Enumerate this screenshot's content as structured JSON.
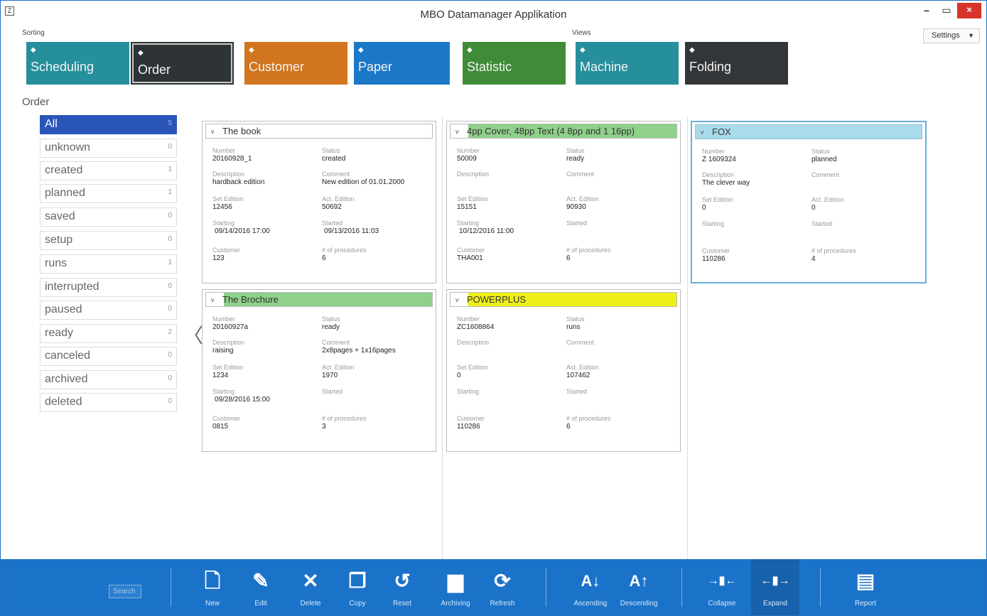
{
  "window": {
    "title": "MBO Datamanager Applikation",
    "app_icon": "Z",
    "min_glyph": "–",
    "max_glyph": "▭",
    "close_glyph": "×"
  },
  "header": {
    "sorting_label": "Sorting",
    "views_label": "Views",
    "settings_label": "Settings",
    "settings_caret": "▼"
  },
  "tiles": [
    {
      "label": "Scheduling",
      "icon": "cube-icon",
      "color": "#268f9c"
    },
    {
      "label": "Order",
      "icon": "cube-icon",
      "color": "#2e3436"
    },
    {
      "label": "Customer",
      "icon": "cube-icon",
      "color": "#d1761e"
    },
    {
      "label": "Paper",
      "icon": "cube-icon",
      "color": "#1b78c6"
    },
    {
      "label": "Statistic",
      "icon": "cube-icon",
      "color": "#3f8b37"
    },
    {
      "label": "Machine",
      "icon": "cube-icon",
      "color": "#268f9c"
    },
    {
      "label": "Folding",
      "icon": "cube-icon",
      "color": "#333638"
    }
  ],
  "section_label": "Order",
  "filters": [
    {
      "label": "All",
      "count": "5"
    },
    {
      "label": "unknown",
      "count": "0"
    },
    {
      "label": "created",
      "count": "1"
    },
    {
      "label": "planned",
      "count": "1"
    },
    {
      "label": "saved",
      "count": "0"
    },
    {
      "label": "setup",
      "count": "0"
    },
    {
      "label": "runs",
      "count": "1"
    },
    {
      "label": "interrupted",
      "count": "0"
    },
    {
      "label": "paused",
      "count": "0"
    },
    {
      "label": "ready",
      "count": "2"
    },
    {
      "label": "canceled",
      "count": "0"
    },
    {
      "label": "archived",
      "count": "0"
    },
    {
      "label": "deleted",
      "count": "0"
    }
  ],
  "collapse_arrow": "〈",
  "field_labels": {
    "number": "Number",
    "status": "Status",
    "description": "Description",
    "comment": "Comment",
    "set_edition": "Set Edition",
    "act_edition": "Act. Edition",
    "starting": "Starting",
    "started": "Started",
    "customer": "Customer",
    "procedures": "# of procedures"
  },
  "cards": [
    {
      "title": "The book",
      "chevron": "v",
      "highlight": "none",
      "number": "20160928_1",
      "status": "created",
      "description": "hardback edition",
      "comment": "New edition of 01.01.2000",
      "set_edition": "12456",
      "act_edition": "50692",
      "starting": "09/14/2016 17:00",
      "started": "09/13/2016 11:03",
      "customer": "123",
      "procedures": "6"
    },
    {
      "title": "The Brochure",
      "chevron": "v",
      "highlight": "#8fd08a",
      "number": "20160927a",
      "status": "ready",
      "description": "raising",
      "comment": "2x8pages + 1x16pages",
      "set_edition": "1234",
      "act_edition": "1970",
      "starting": "09/28/2016 15:00",
      "started": "",
      "customer": "0815",
      "procedures": "3"
    },
    {
      "title": "4pp Cover, 48pp Text (4 8pp and 1 16pp)",
      "chevron": "v",
      "highlight": "#8fd08a",
      "number": "50009",
      "status": "ready",
      "description": "",
      "comment": "",
      "set_edition": "15151",
      "act_edition": "90930",
      "starting": "10/12/2016 11:00",
      "started": "",
      "customer": "THA001",
      "procedures": "6"
    },
    {
      "title": "POWERPLUS",
      "chevron": "v",
      "highlight": "#eeee1b",
      "number": "ZC1608864",
      "status": "runs",
      "description": "",
      "comment": "",
      "set_edition": "0",
      "act_edition": "107462",
      "starting": "",
      "started": "",
      "customer": "110286",
      "procedures": "6"
    },
    {
      "title": "FOX",
      "chevron": "v",
      "highlight": "#a9dbea",
      "number": "Z 1609324",
      "status": "planned",
      "description": "The clever way",
      "comment": "",
      "set_edition": "0",
      "act_edition": "0",
      "starting": "",
      "started": "",
      "customer": "110286",
      "procedures": "4"
    }
  ],
  "toolbar": {
    "search_placeholder": "Search",
    "buttons": [
      {
        "label": "New",
        "icon": "new-document-icon",
        "glyph": "🗋"
      },
      {
        "label": "Edit",
        "icon": "edit-icon",
        "glyph": "✎"
      },
      {
        "label": "Delete",
        "icon": "delete-icon",
        "glyph": "✕"
      },
      {
        "label": "Copy",
        "icon": "copy-icon",
        "glyph": "❐"
      },
      {
        "label": "Reset",
        "icon": "reset-icon",
        "glyph": "↺"
      },
      {
        "label": "Archiving",
        "icon": "archive-icon",
        "glyph": "▆"
      },
      {
        "label": "Refresh",
        "icon": "refresh-icon",
        "glyph": "⟳"
      },
      {
        "label": "Ascending",
        "icon": "sort-ascending-icon",
        "glyph": "A↓"
      },
      {
        "label": "Descending",
        "icon": "sort-descending-icon",
        "glyph": "A↑"
      },
      {
        "label": "Collapse",
        "icon": "collapse-icon",
        "glyph": "→▮←"
      },
      {
        "label": "Expand",
        "icon": "expand-icon",
        "glyph": "←▮→"
      },
      {
        "label": "Report",
        "icon": "report-icon",
        "glyph": "▤"
      }
    ]
  },
  "colors": {
    "accent": "#1b73c9",
    "filter_active": "#2a55b8",
    "card_selected_border": "#6aaedc"
  }
}
